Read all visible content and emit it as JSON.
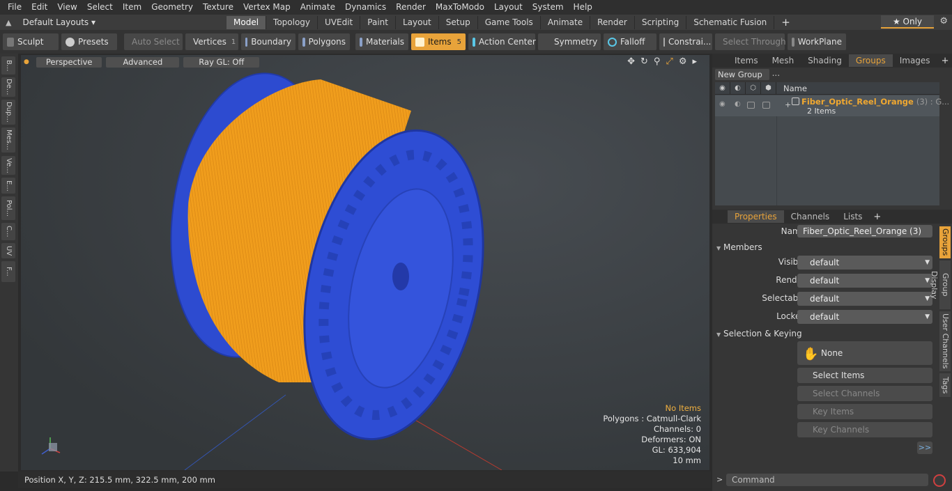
{
  "menu": [
    "File",
    "Edit",
    "View",
    "Select",
    "Item",
    "Geometry",
    "Texture",
    "Vertex Map",
    "Animate",
    "Dynamics",
    "Render",
    "MaxToModo",
    "Layout",
    "System",
    "Help"
  ],
  "layouts_label": "Default Layouts ▾",
  "mode_tabs": [
    "Model",
    "Topology",
    "UVEdit",
    "Paint",
    "Layout",
    "Setup",
    "Game Tools",
    "Animate",
    "Render",
    "Scripting",
    "Schematic Fusion"
  ],
  "only_label": "★ Only",
  "toolbar": {
    "sculpt": "Sculpt",
    "presets": "Presets",
    "auto_select": "Auto Select",
    "vertices": "Vertices",
    "vertices_count": "1",
    "boundary": "Boundary",
    "polygons": "Polygons",
    "materials": "Materials",
    "items": "Items",
    "items_count": "5",
    "action_center": "Action Center",
    "symmetry": "Symmetry",
    "falloff": "Falloff",
    "constraints": "Constrai...",
    "select_through": "Select Through",
    "workplane": "WorkPlane"
  },
  "left_strip": [
    "B...",
    "De...",
    "Dup...",
    "Mes...",
    "Ve...",
    "E...",
    "Pol...",
    "C...",
    "UV",
    "F..."
  ],
  "viewport": {
    "perspective": "Perspective",
    "advanced": "Advanced",
    "raygl": "Ray GL: Off",
    "info": {
      "no_items": "No Items",
      "polygons": "Polygons : Catmull-Clark",
      "channels": "Channels: 0",
      "deformers": "Deformers: ON",
      "gl": "GL: 633,904",
      "unit": "10 mm"
    }
  },
  "status": "Position X, Y, Z:   215.5 mm, 322.5 mm, 200 mm",
  "right_panel": {
    "top_tabs": [
      "Items",
      "Mesh ...",
      "Shading",
      "Groups",
      "Images"
    ],
    "new_group": "New Group",
    "list_header_name": "Name",
    "group_name": "Fiber_Optic_Reel_Orange",
    "group_count_suffix": "(3) : G...",
    "group_items": "2 Items",
    "prop_tabs": [
      "Properties",
      "Channels",
      "Lists"
    ],
    "name_label": "Name",
    "name_value": "Fiber_Optic_Reel_Orange (3)",
    "members_label": "Members",
    "visible_label": "Visible",
    "render_label": "Render",
    "selectable_label": "Selectable",
    "locked_label": "Locked",
    "default_value": "default",
    "sel_keying_label": "Selection & Keying",
    "none_label": "None",
    "select_items": "Select Items",
    "select_channels": "Select Channels",
    "key_items": "Key Items",
    "key_channels": "Key Channels",
    "more": ">>",
    "vtabs": [
      "Groups",
      "Group Display",
      "User Channels",
      "Tags"
    ]
  },
  "command_placeholder": "Command",
  "colors": {
    "accent": "#e8a33a",
    "reel_blue": "#2f4fd0",
    "cable_orange": "#f5a21e"
  }
}
